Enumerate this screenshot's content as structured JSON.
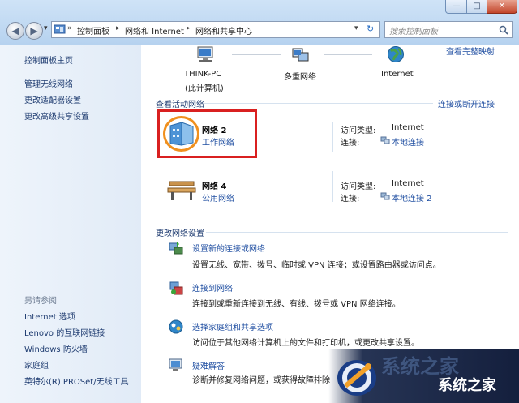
{
  "window": {
    "minimize_glyph": "—",
    "maximize_glyph": "□",
    "close_glyph": "✕"
  },
  "nav": {
    "back_glyph": "◀",
    "forward_glyph": "▶",
    "dropdown_glyph": "▾",
    "refresh_glyph": "↻"
  },
  "breadcrumb": {
    "root_glyph": "»",
    "items": [
      "控制面板",
      "网络和 Internet",
      "网络和共享中心"
    ],
    "separator": "▸"
  },
  "search": {
    "placeholder": "搜索控制面板"
  },
  "sidebar": {
    "home": "控制面板主页",
    "tasks": [
      "管理无线网络",
      "更改适配器设置",
      "更改高级共享设置"
    ],
    "see_also_title": "另请参阅",
    "see_also": [
      "Internet 选项",
      "Lenovo 的互联网链接",
      "Windows 防火墙",
      "家庭组",
      "英特尔(R) PROSet/无线工具"
    ]
  },
  "map": {
    "view_full_map": "查看完整映射",
    "nodes": [
      {
        "name": "THINK-PC",
        "sub": "(此计算机)",
        "icon": "computer-icon"
      },
      {
        "name": "多重网络",
        "sub": "",
        "icon": "network-icon"
      },
      {
        "name": "Internet",
        "sub": "",
        "icon": "globe-icon"
      }
    ]
  },
  "active": {
    "title": "查看活动网络",
    "connect_disconnect": "连接或断开连接",
    "networks": [
      {
        "name": "网络  2",
        "type_link": "工作网络",
        "access_label": "访问类型:",
        "access_value": "Internet",
        "conn_label": "连接:",
        "conn_value": "本地连接",
        "icon": "work-network-icon"
      },
      {
        "name": "网络  4",
        "type_link": "公用网络",
        "access_label": "访问类型:",
        "access_value": "Internet",
        "conn_label": "连接:",
        "conn_value": "本地连接 2",
        "icon": "public-bench-icon"
      }
    ]
  },
  "settings": {
    "title": "更改网络设置",
    "items": [
      {
        "link": "设置新的连接或网络",
        "desc": "设置无线、宽带、拨号、临时或 VPN 连接；或设置路由器或访问点。",
        "icon": "new-connection-icon"
      },
      {
        "link": "连接到网络",
        "desc": "连接到或重新连接到无线、有线、拨号或 VPN 网络连接。",
        "icon": "connect-network-icon"
      },
      {
        "link": "选择家庭组和共享选项",
        "desc": "访问位于其他网络计算机上的文件和打印机，或更改共享设置。",
        "icon": "homegroup-icon"
      },
      {
        "link": "疑难解答",
        "desc": "诊断并修复网络问题，或获得故障排除",
        "icon": "troubleshoot-icon"
      }
    ]
  },
  "watermark": {
    "text": "系统之家",
    "faint": "系统之家"
  },
  "colors": {
    "highlight_box": "#d92020",
    "highlight_circle": "#f0901e",
    "link": "#1f4ea1"
  }
}
